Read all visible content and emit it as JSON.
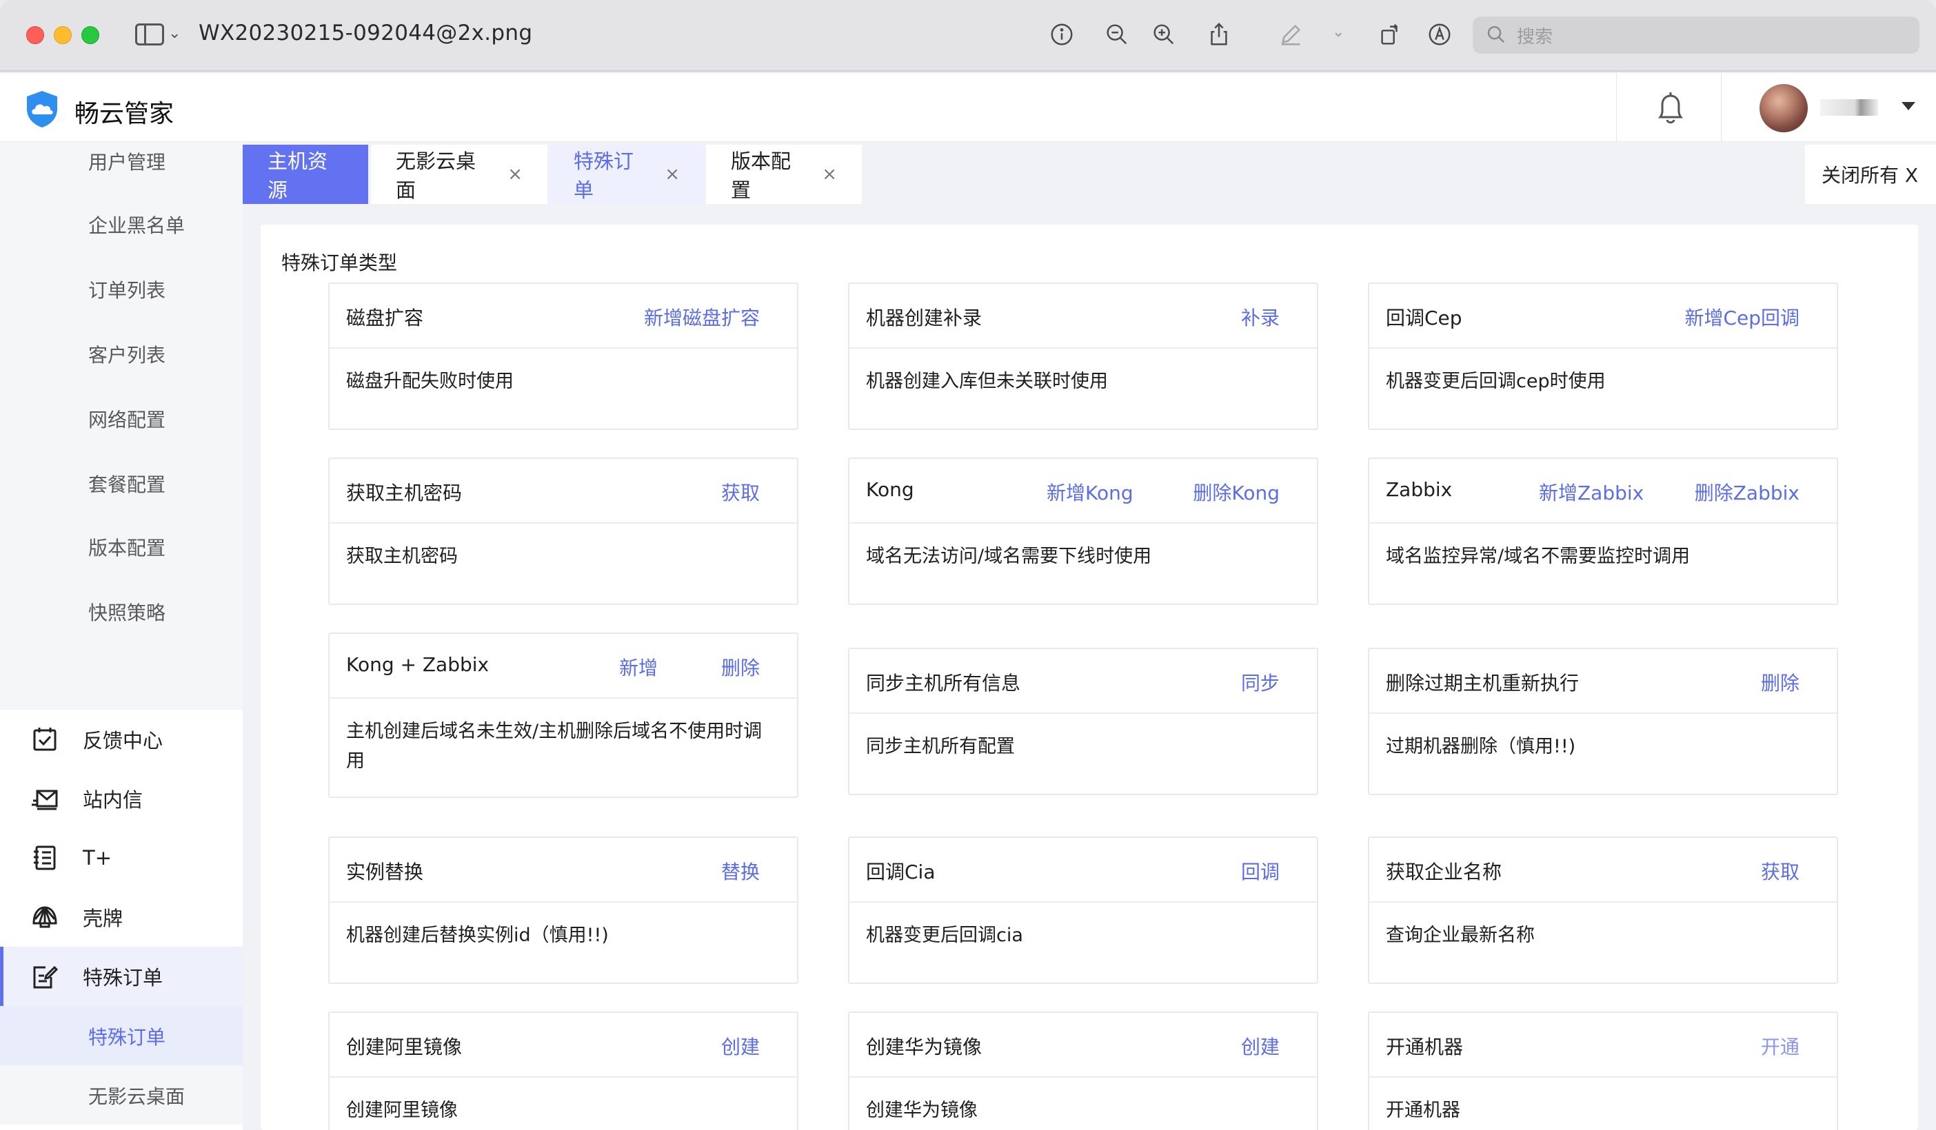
{
  "window": {
    "title": "WX20230215-092044@2x.png",
    "search_placeholder": "搜索"
  },
  "app": {
    "brand": "畅云管家"
  },
  "sidebar": {
    "sub_items": [
      "用户管理",
      "企业黑名单",
      "订单列表",
      "客户列表",
      "网络配置",
      "套餐配置",
      "版本配置",
      "快照策略"
    ],
    "menu": [
      "反馈中心",
      "站内信",
      "T+",
      "壳牌",
      "特殊订单"
    ],
    "special_sub": [
      "特殊订单",
      "无影云桌面"
    ]
  },
  "tabs": [
    "主机资源",
    "无影云桌面",
    "特殊订单",
    "版本配置"
  ],
  "tab_close": "×",
  "close_all": "关闭所有 X",
  "panel_title": "特殊订单类型",
  "cards": [
    {
      "title": "磁盘扩容",
      "a1": "新增磁盘扩容",
      "desc": "磁盘升配失败时使用"
    },
    {
      "title": "机器创建补录",
      "a1": "补录",
      "desc": "机器创建入库但未关联时使用"
    },
    {
      "title": "回调Cep",
      "a1": "新增Cep回调",
      "desc": "机器变更后回调cep时使用"
    },
    {
      "title": "获取主机密码",
      "a1": "获取",
      "desc": "获取主机密码"
    },
    {
      "title": "Kong",
      "a1": "新增Kong",
      "a2": "删除Kong",
      "desc": "域名无法访问/域名需要下线时使用"
    },
    {
      "title": "Zabbix",
      "a1": "新增Zabbix",
      "a2": "删除Zabbix",
      "desc": "域名监控异常/域名不需要监控时调用"
    },
    {
      "title": "Kong + Zabbix",
      "a1": "新增",
      "a2": "删除",
      "desc": "主机创建后域名未生效/主机删除后域名不使用时调用"
    },
    {
      "title": "同步主机所有信息",
      "a1": "同步",
      "desc": "同步主机所有配置"
    },
    {
      "title": "删除过期主机重新执行",
      "a1": "删除",
      "desc": "过期机器删除（慎用!!)"
    },
    {
      "title": "实例替换",
      "a1": "替换",
      "desc": "机器创建后替换实例id（慎用!!)"
    },
    {
      "title": "回调Cia",
      "a1": "回调",
      "desc": "机器变更后回调cia"
    },
    {
      "title": "获取企业名称",
      "a1": "获取",
      "desc": "查询企业最新名称"
    },
    {
      "title": "创建阿里镜像",
      "a1": "创建",
      "desc": "创建阿里镜像"
    },
    {
      "title": "创建华为镜像",
      "a1": "创建",
      "desc": "创建华为镜像"
    },
    {
      "title": "开通机器",
      "a1": "开通",
      "desc": "开通机器"
    }
  ]
}
